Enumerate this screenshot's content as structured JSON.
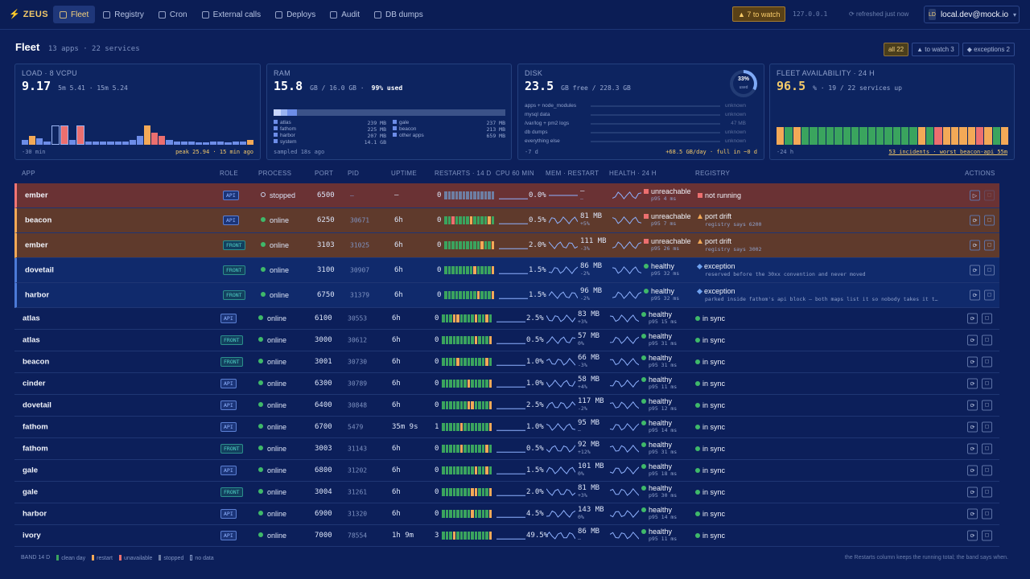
{
  "brand": {
    "mark": "⚡",
    "name": "ZEUS"
  },
  "nav": [
    {
      "label": "Fleet",
      "active": true
    },
    {
      "label": "Registry"
    },
    {
      "label": "Cron"
    },
    {
      "label": "External calls"
    },
    {
      "label": "Deploys"
    },
    {
      "label": "Audit"
    },
    {
      "label": "DB dumps"
    }
  ],
  "header": {
    "watch": "▲ 7  to watch",
    "host": "127.0.0.1",
    "refresh": "refreshed just now",
    "user_initials": "LD",
    "user": "local.dev@mock.io"
  },
  "fleet": {
    "title": "Fleet",
    "subtitle": "13 apps · 22 services",
    "filters": [
      "all 22",
      "▲ to watch 3",
      "◆ exceptions 2"
    ]
  },
  "cards": {
    "load": {
      "label": "LOAD · 8 VCPU",
      "value": "9.17",
      "sub": "5m 5.41 · 15m 5.24",
      "foot": "-30 min",
      "peak": "peak 25.94 · 15 min ago",
      "bars": [
        0.2,
        0.4,
        0.3,
        0.15,
        0.85,
        0.85,
        0.2,
        0.85,
        0.15,
        0.15,
        0.15,
        0.15,
        0.15,
        0.15,
        0.2,
        0.4,
        0.85,
        0.55,
        0.4,
        0.2,
        0.15,
        0.15,
        0.15,
        0.12,
        0.12,
        0.15,
        0.15,
        0.12,
        0.15,
        0.15,
        0.2
      ]
    },
    "ram": {
      "label": "RAM",
      "value": "15.8",
      "sub": "GB / 16.0 GB ·",
      "used": "99% used",
      "foot": "sampled 18s ago",
      "list": [
        [
          "atlas",
          "239 MB"
        ],
        [
          "gale",
          "237 MB"
        ],
        [
          "fathom",
          "225 MB"
        ],
        [
          "beacon",
          "213 MB"
        ],
        [
          "harbor",
          "207 MB"
        ],
        [
          "other apps",
          "659 MB"
        ],
        [
          "system",
          "14.1 GB"
        ],
        [
          "",
          ""
        ]
      ]
    },
    "disk": {
      "label": "DISK",
      "value": "23.5",
      "sub": "GB free / 228.3 GB",
      "pct": "33%",
      "pct_label": "used",
      "foot": "-7 d",
      "rate": "+68.5 GB/day · full in ~0 d",
      "list": [
        [
          "apps + node_modules",
          "unknown"
        ],
        [
          "mysql data",
          "unknown"
        ],
        [
          "/var/log + pm2 logs",
          "47 MB"
        ],
        [
          "db dumps",
          "unknown"
        ],
        [
          "everything else",
          "unknown"
        ]
      ]
    },
    "avail": {
      "label": "FLEET AVAILABILITY · 24 H",
      "value": "96.5",
      "sub": "% · 19 / 22 services up",
      "foot": "-24 h",
      "incidents": "53 incidents · worst beacon-api 55m",
      "bars": [
        "o",
        "g",
        "o",
        "g",
        "g",
        "g",
        "g",
        "g",
        "g",
        "g",
        "g",
        "g",
        "g",
        "g",
        "g",
        "g",
        "g",
        "o",
        "g",
        "r",
        "o",
        "o",
        "o",
        "o",
        "r",
        "o",
        "g",
        "o"
      ]
    }
  },
  "columns": [
    "APP",
    "ROLE",
    "PROCESS",
    "PORT",
    "PID",
    "UPTIME",
    "RESTARTS · 14 D",
    "CPU 60 MIN",
    "MEM · RESTART",
    "HEALTH · 24 H",
    "REGISTRY",
    "ACTIONS"
  ],
  "rows": [
    {
      "app": "ember",
      "role": "API",
      "proc": "stopped",
      "port": "6500",
      "pid": "—",
      "up": "—",
      "rst": "0",
      "cpu": "0.0%",
      "mem": "—",
      "memd": "—",
      "health": "unreachable",
      "p95": "p95 4 ms",
      "reg": "not running",
      "regsub": "",
      "kind": "down",
      "band": "ssssssssssssss",
      "hstate": "bad",
      "rstate": "bad"
    },
    {
      "app": "beacon",
      "role": "API",
      "proc": "online",
      "port": "6250",
      "pid": "30671",
      "up": "6h",
      "rst": "0",
      "cpu": "0.5%",
      "mem": "81 MB",
      "memd": "+5%",
      "health": "unreachable",
      "p95": "p95 7 ms",
      "reg": "port drift",
      "regsub": "registry says 6200",
      "kind": "drift",
      "band": "gguggggrggggrg",
      "hstate": "bad",
      "rstate": "warn"
    },
    {
      "app": "ember",
      "role": "FRONT",
      "proc": "online",
      "port": "3103",
      "pid": "31025",
      "up": "6h",
      "rst": "0",
      "cpu": "2.0%",
      "mem": "111 MB",
      "memd": "-3%",
      "health": "unreachable",
      "p95": "p95 26 ms",
      "reg": "port drift",
      "regsub": "registry says 3002",
      "kind": "drift",
      "band": "ggggggggggrggr",
      "hstate": "bad",
      "rstate": "warn"
    },
    {
      "app": "dovetail",
      "role": "FRONT",
      "proc": "online",
      "port": "3100",
      "pid": "30907",
      "up": "6h",
      "rst": "0",
      "cpu": "1.5%",
      "mem": "86 MB",
      "memd": "-2%",
      "health": "healthy",
      "p95": "p95 32 ms",
      "reg": "exception",
      "regsub": "reserved before the 30xx convention and never moved",
      "kind": "exc",
      "band": "ggggggggrggggr",
      "hstate": "good",
      "rstate": "exc"
    },
    {
      "app": "harbor",
      "role": "FRONT",
      "proc": "online",
      "port": "6750",
      "pid": "31379",
      "up": "6h",
      "rst": "0",
      "cpu": "1.5%",
      "mem": "96 MB",
      "memd": "-2%",
      "health": "healthy",
      "p95": "p95 32 ms",
      "reg": "exception",
      "regsub": "parked inside fathom's api block — both maps list it so nobody takes it t…",
      "kind": "exc",
      "band": "gggggggggrgggr",
      "hstate": "good",
      "rstate": "exc"
    },
    {
      "app": "atlas",
      "role": "API",
      "proc": "online",
      "port": "6100",
      "pid": "30553",
      "up": "6h",
      "rst": "0",
      "cpu": "2.5%",
      "mem": "83 MB",
      "memd": "+3%",
      "health": "healthy",
      "p95": "p95 15 ms",
      "reg": "in sync",
      "regsub": "",
      "kind": "",
      "band": "gggrrggggrggrg",
      "hstate": "good",
      "rstate": "sync"
    },
    {
      "app": "atlas",
      "role": "FRONT",
      "proc": "online",
      "port": "3000",
      "pid": "30612",
      "up": "6h",
      "rst": "0",
      "cpu": "0.5%",
      "mem": "57 MB",
      "memd": "0%",
      "health": "healthy",
      "p95": "p95 31 ms",
      "reg": "in sync",
      "regsub": "",
      "kind": "",
      "band": "gggggggggrgggr",
      "hstate": "good",
      "rstate": "sync"
    },
    {
      "app": "beacon",
      "role": "FRONT",
      "proc": "online",
      "port": "3001",
      "pid": "30730",
      "up": "6h",
      "rst": "0",
      "cpu": "1.0%",
      "mem": "66 MB",
      "memd": "-3%",
      "health": "healthy",
      "p95": "p95 31 ms",
      "reg": "in sync",
      "regsub": "",
      "kind": "",
      "band": "ggggrgggggggrg",
      "hstate": "good",
      "rstate": "sync"
    },
    {
      "app": "cinder",
      "role": "API",
      "proc": "online",
      "port": "6300",
      "pid": "30789",
      "up": "6h",
      "rst": "0",
      "cpu": "1.0%",
      "mem": "58 MB",
      "memd": "+4%",
      "health": "healthy",
      "p95": "p95 11 ms",
      "reg": "in sync",
      "regsub": "",
      "kind": "",
      "band": "gggggggrgggggr",
      "hstate": "good",
      "rstate": "sync"
    },
    {
      "app": "dovetail",
      "role": "API",
      "proc": "online",
      "port": "6400",
      "pid": "30848",
      "up": "6h",
      "rst": "0",
      "cpu": "2.5%",
      "mem": "117 MB",
      "memd": "-2%",
      "health": "healthy",
      "p95": "p95 12 ms",
      "reg": "in sync",
      "regsub": "",
      "kind": "",
      "band": "gggggggrrggggr",
      "hstate": "good",
      "rstate": "sync"
    },
    {
      "app": "fathom",
      "role": "API",
      "proc": "online",
      "port": "6700",
      "pid": "5479",
      "up": "35m 9s",
      "rst": "1",
      "cpu": "1.0%",
      "mem": "95 MB",
      "memd": "—",
      "health": "healthy",
      "p95": "p95 14 ms",
      "reg": "in sync",
      "regsub": "",
      "kind": "",
      "band": "gggggrgggggggr",
      "hstate": "good",
      "rstate": "sync"
    },
    {
      "app": "fathom",
      "role": "FRONT",
      "proc": "online",
      "port": "3003",
      "pid": "31143",
      "up": "6h",
      "rst": "0",
      "cpu": "0.5%",
      "mem": "92 MB",
      "memd": "+12%",
      "health": "healthy",
      "p95": "p95 31 ms",
      "reg": "in sync",
      "regsub": "",
      "kind": "",
      "band": "gggggrggggggrg",
      "hstate": "good",
      "rstate": "sync"
    },
    {
      "app": "gale",
      "role": "API",
      "proc": "online",
      "port": "6800",
      "pid": "31202",
      "up": "6h",
      "rst": "0",
      "cpu": "1.5%",
      "mem": "101 MB",
      "memd": "0%",
      "health": "healthy",
      "p95": "p95 18 ms",
      "reg": "in sync",
      "regsub": "",
      "kind": "",
      "band": "gggggggggrggrg",
      "hstate": "good",
      "rstate": "sync"
    },
    {
      "app": "gale",
      "role": "FRONT",
      "proc": "online",
      "port": "3004",
      "pid": "31261",
      "up": "6h",
      "rst": "0",
      "cpu": "2.0%",
      "mem": "81 MB",
      "memd": "+3%",
      "health": "healthy",
      "p95": "p95 30 ms",
      "reg": "in sync",
      "regsub": "",
      "kind": "",
      "band": "ggggggggrrgggr",
      "hstate": "good",
      "rstate": "sync"
    },
    {
      "app": "harbor",
      "role": "API",
      "proc": "online",
      "port": "6900",
      "pid": "31320",
      "up": "6h",
      "rst": "0",
      "cpu": "4.5%",
      "mem": "143 MB",
      "memd": "0%",
      "health": "healthy",
      "p95": "p95 14 ms",
      "reg": "in sync",
      "regsub": "",
      "kind": "",
      "band": "ggggggggrggggr",
      "hstate": "good",
      "rstate": "sync"
    },
    {
      "app": "ivory",
      "role": "API",
      "proc": "online",
      "port": "7000",
      "pid": "78554",
      "up": "1h 9m",
      "rst": "3",
      "cpu": "49.5%",
      "mem": "86 MB",
      "memd": "—",
      "health": "healthy",
      "p95": "p95 11 ms",
      "reg": "in sync",
      "regsub": "",
      "kind": "",
      "band": "gggrgggggggggr",
      "hstate": "good",
      "rstate": "sync"
    }
  ],
  "footer": {
    "label": "BAND 14 D",
    "items": [
      [
        "clean day",
        "#3aa45e"
      ],
      [
        "restart",
        "#f3a957"
      ],
      [
        "unavailable",
        "#ec6f6f"
      ],
      [
        "stopped",
        "#6e7ea3"
      ],
      [
        "no data",
        "transparent"
      ]
    ],
    "note": "the Restarts column keeps the running total; the band says when."
  }
}
